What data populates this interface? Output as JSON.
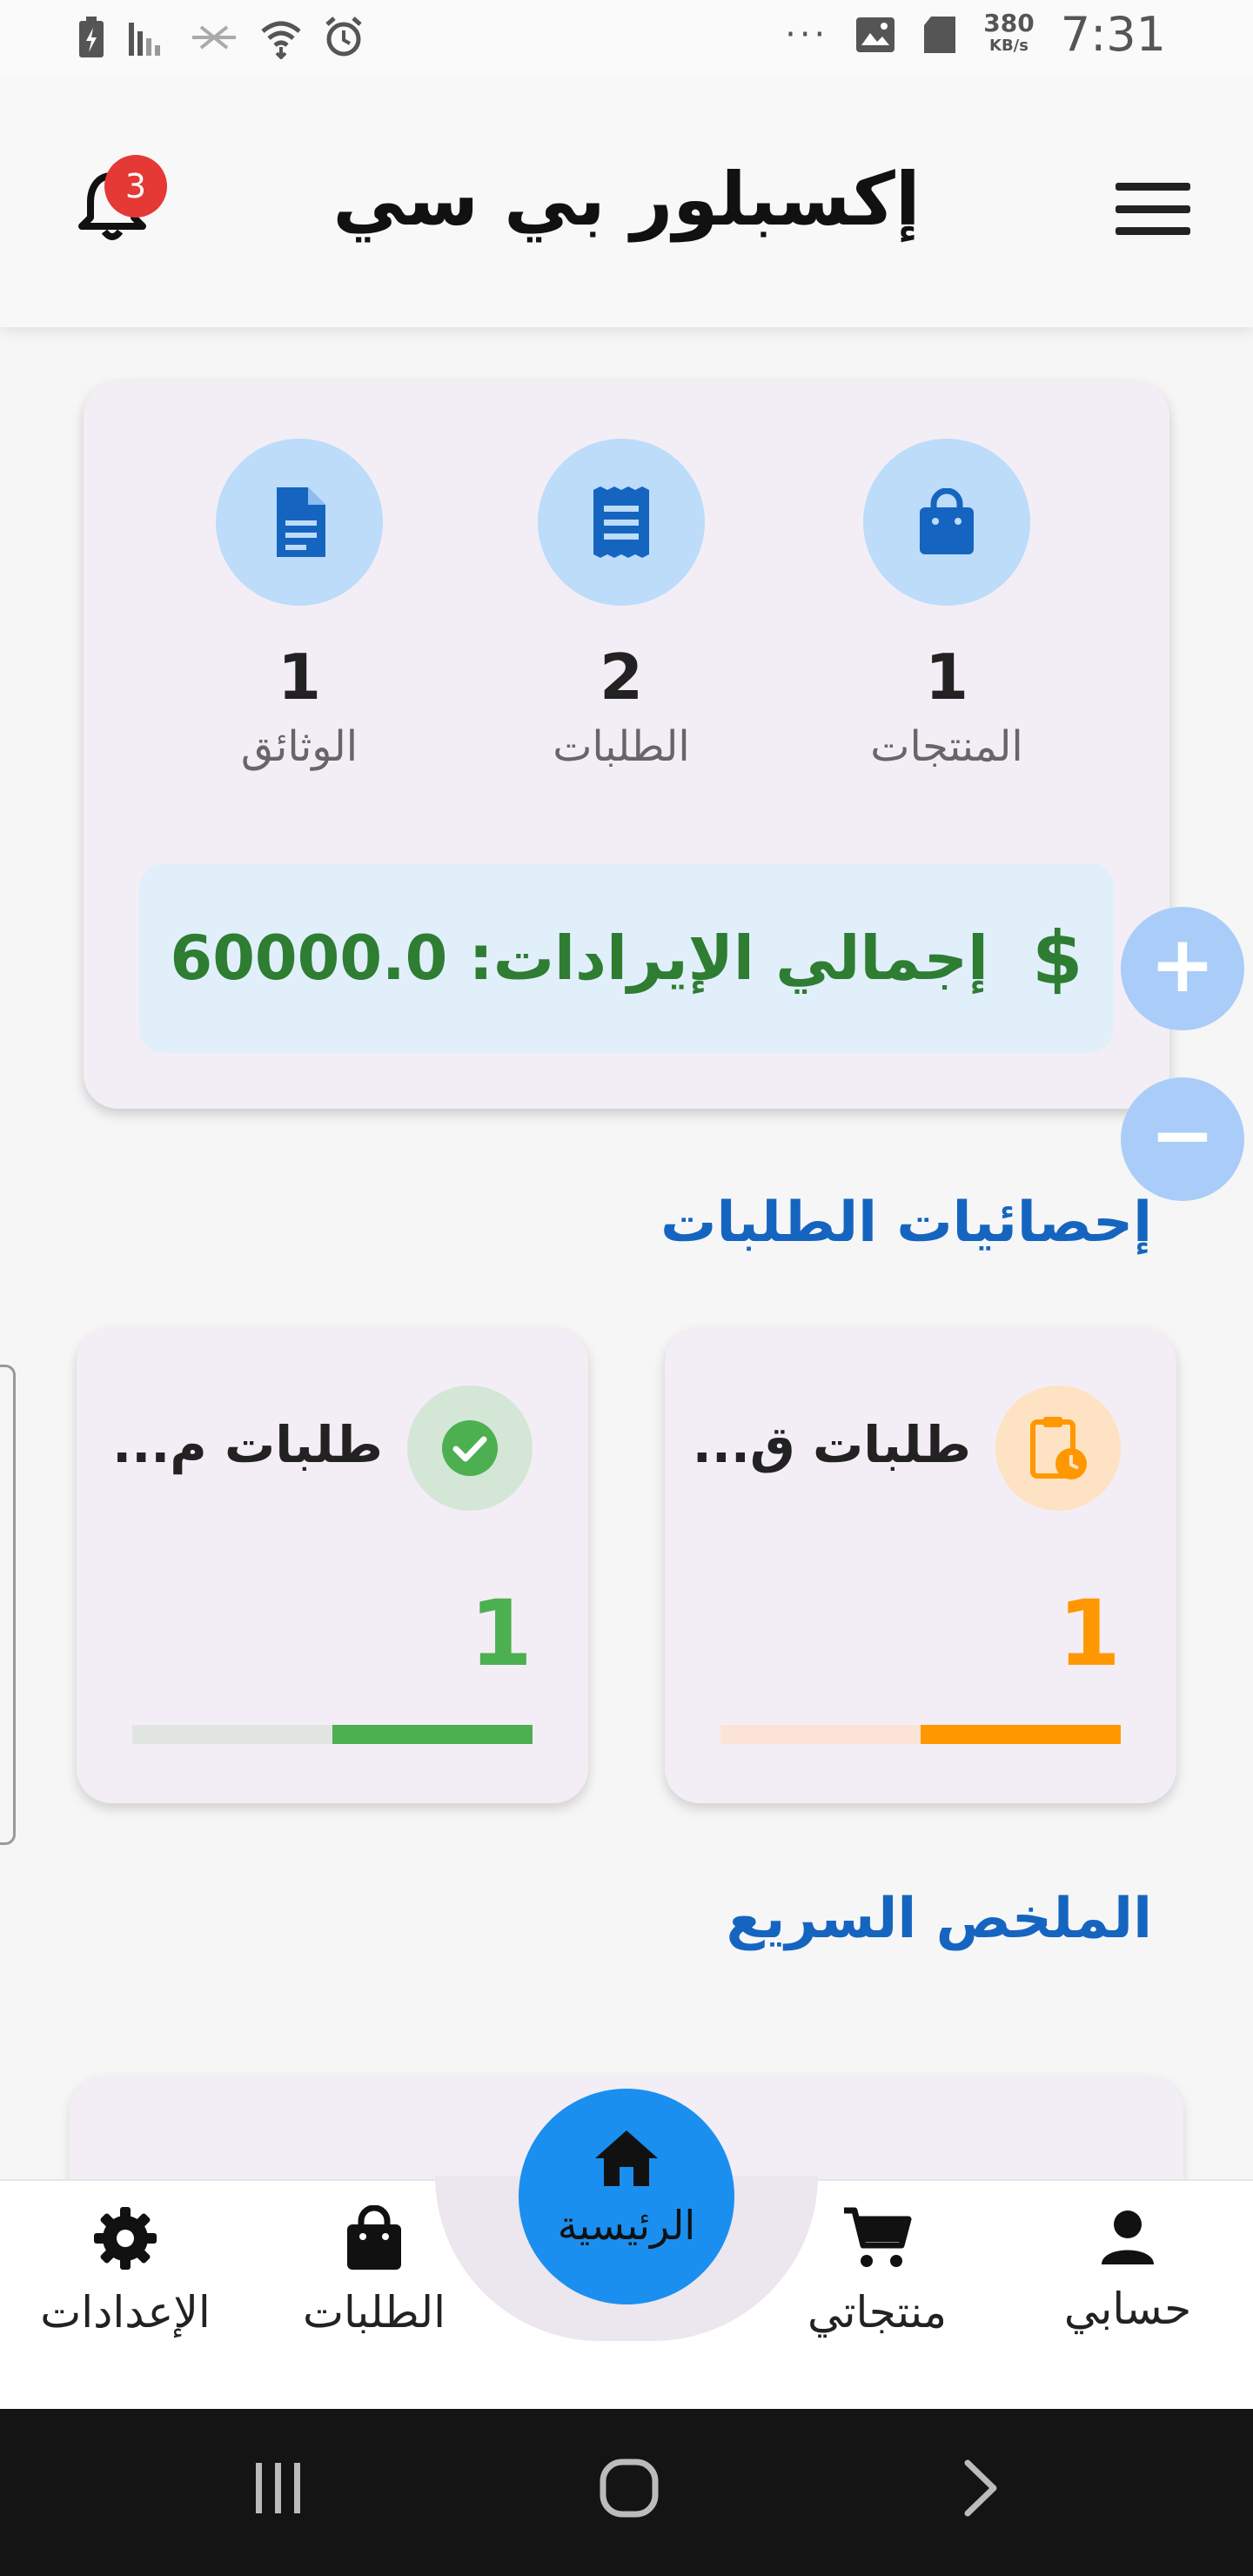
{
  "status_bar": {
    "time": "7:31",
    "speed_value": "380",
    "speed_unit": "KB/s",
    "more": "···"
  },
  "app_bar": {
    "title": "إكسبلور بي سي",
    "notification_count": "3"
  },
  "stats": {
    "items": [
      {
        "label": "المنتجات",
        "value": "1",
        "icon": "shopping-bag-icon"
      },
      {
        "label": "الطلبات",
        "value": "2",
        "icon": "receipt-icon"
      },
      {
        "label": "الوثائق",
        "value": "1",
        "icon": "document-icon"
      }
    ],
    "revenue_text": "إجمالي الإيرادات: 60000.0",
    "revenue_icon": "$"
  },
  "zoom": {
    "in": "+",
    "out": "−"
  },
  "orders_section": {
    "title": "إحصائيات الطلبات",
    "cards": [
      {
        "title": "طلبات ق...",
        "value": "1",
        "icon": "clipboard-clock-icon",
        "color": "#ff9800",
        "progress": 0.5
      },
      {
        "title": "طلبات م...",
        "value": "1",
        "icon": "check-circle-icon",
        "color": "#4caf50",
        "progress": 0.5
      }
    ]
  },
  "summary_section": {
    "title": "الملخص السريع"
  },
  "bottom_nav": {
    "items": [
      {
        "label": "حسابي",
        "icon": "person-icon"
      },
      {
        "label": "منتجاتي",
        "icon": "cart-icon"
      },
      {
        "label": "الرئيسية",
        "icon": "home-icon"
      },
      {
        "label": "الطلبات",
        "icon": "shopping-bag-icon"
      },
      {
        "label": "الإعدادات",
        "icon": "gear-icon"
      }
    ]
  },
  "colors": {
    "primary": "#1565c0",
    "revenue_green": "#2e7d32",
    "pending_orange": "#ff9800",
    "complete_green": "#4caf50",
    "home_fab": "#1a8ff0"
  }
}
